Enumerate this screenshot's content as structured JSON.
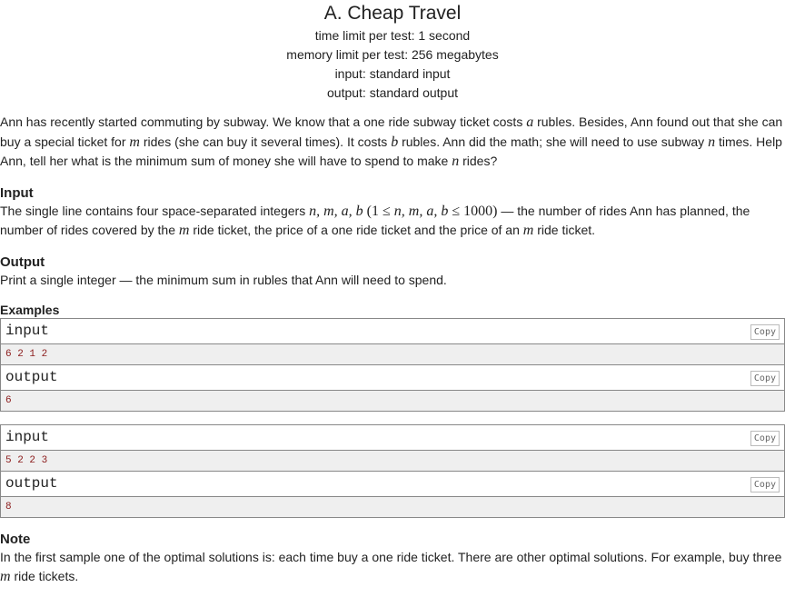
{
  "problem": {
    "title": "A. Cheap Travel",
    "time_limit": "time limit per test: 1 second",
    "memory_limit": "memory limit per test: 256 megabytes",
    "input_file": "input: standard input",
    "output_file": "output: standard output"
  },
  "statement": {
    "t1": "Ann has recently started commuting by subway. We know that a one ride subway ticket costs ",
    "v_a": "a",
    "t2": " rubles. Besides, Ann found out that she can buy a special ticket for ",
    "v_m": "m",
    "t3": " rides (she can buy it several times). It costs ",
    "v_b": "b",
    "t4": " rubles. Ann did the math; she will need to use subway ",
    "v_n": "n",
    "t5": " times. Help Ann, tell her what is the minimum sum of money she will have to spend to make ",
    "v_n2": "n",
    "t6": " rides?"
  },
  "input_section": {
    "title": "Input",
    "t1": "The single line contains four space-separated integers ",
    "vars": "n, m, a, b",
    "constraint_open": " (1 ≤ ",
    "constraint_vars": "n, m, a, b",
    "constraint_close": " ≤ 1000)",
    "t2": " — the number of rides Ann has planned, the number of rides covered by the ",
    "v_m": "m",
    "t3": " ride ticket, the price of a one ride ticket and the price of an ",
    "v_m2": "m",
    "t4": " ride ticket."
  },
  "output_section": {
    "title": "Output",
    "text": "Print a single integer — the minimum sum in rubles that Ann will need to spend."
  },
  "examples": {
    "title": "Examples",
    "input_label": "input",
    "output_label": "output",
    "copy_label": "Copy",
    "items": [
      {
        "input": "6 2 1 2",
        "output": "6"
      },
      {
        "input": "5 2 2 3",
        "output": "8"
      }
    ]
  },
  "note": {
    "title": "Note",
    "t1": "In the first sample one of the optimal solutions is: each time buy a one ride ticket. There are other optimal solutions. For example, buy three ",
    "v_m": "m",
    "t2": " ride tickets."
  }
}
